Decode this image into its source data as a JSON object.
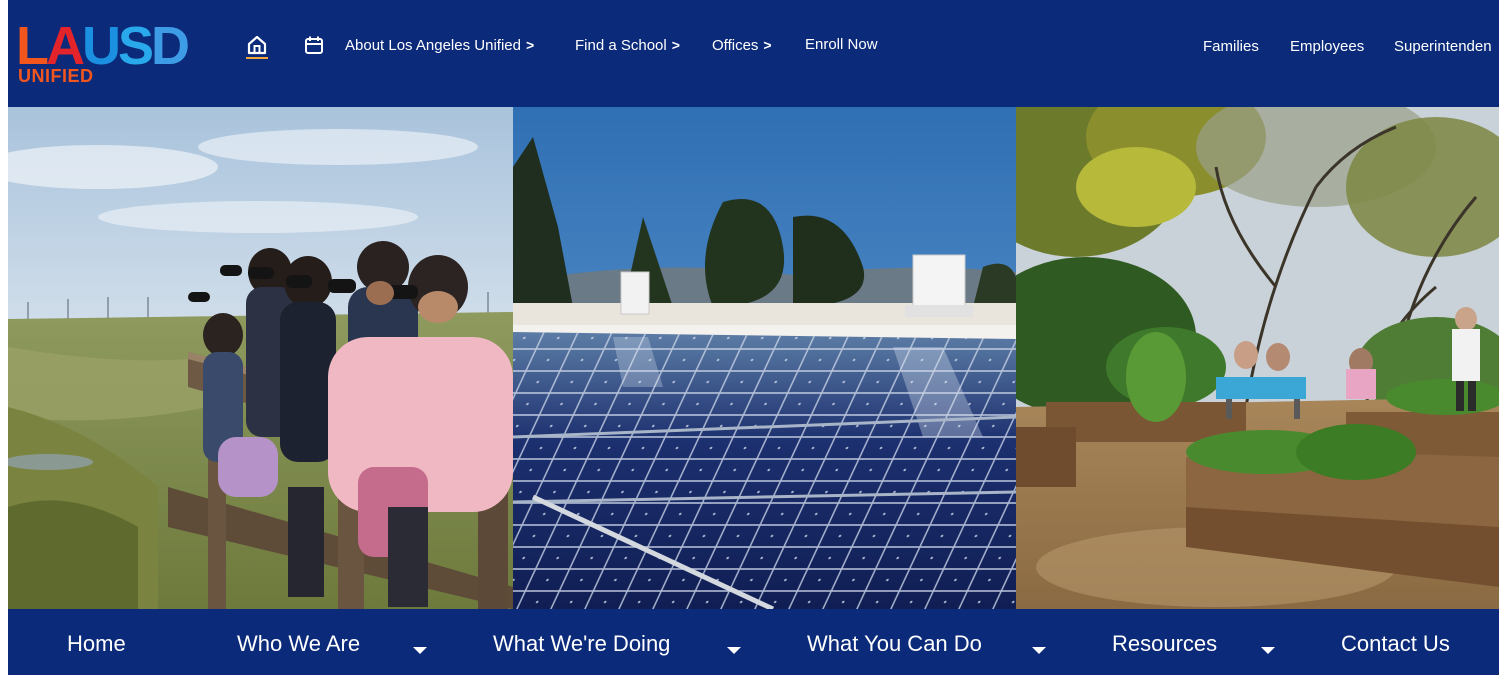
{
  "header": {
    "logo": {
      "letters": [
        "L",
        "A",
        "U",
        "S",
        "D"
      ],
      "subtitle": "UNIFIED",
      "colors": [
        "#f2561d",
        "#e3242b",
        "#1b8fe0",
        "#2aa8ec",
        "#3e9be6"
      ]
    },
    "home_icon": "home-icon",
    "calendar_icon": "calendar-icon",
    "nav": [
      {
        "label": "About Los Angeles Unified",
        "chevron": ">"
      },
      {
        "label": "Find a School",
        "chevron": ">"
      },
      {
        "label": "Offices",
        "chevron": ">"
      },
      {
        "label": "Enroll Now",
        "chevron": ""
      }
    ],
    "right_links": [
      "Families",
      "Employees",
      "Superintenden"
    ]
  },
  "hero": {
    "panels": [
      "students-binoculars-photo",
      "rooftop-solar-panels-photo",
      "school-garden-photo"
    ]
  },
  "bottom_nav": {
    "items": [
      {
        "label": "Home",
        "has_dropdown": false
      },
      {
        "label": "Who We Are",
        "has_dropdown": true
      },
      {
        "label": "What We're Doing",
        "has_dropdown": true
      },
      {
        "label": "What You Can Do",
        "has_dropdown": true
      },
      {
        "label": "Resources",
        "has_dropdown": true
      },
      {
        "label": "Contact Us",
        "has_dropdown": false
      }
    ]
  },
  "colors": {
    "header_bg": "#0b2a7a",
    "accent_underline": "#f2a33a",
    "text": "#ffffff"
  }
}
